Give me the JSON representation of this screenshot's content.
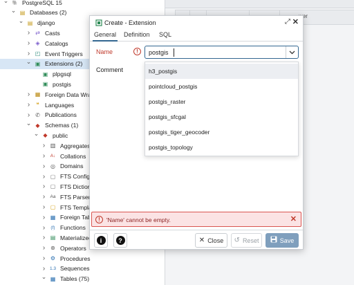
{
  "tree": {
    "items": [
      {
        "label": "PostgreSQL 15",
        "icon": "elephant-icon",
        "level": 0,
        "expanded": true,
        "selected": false
      },
      {
        "label": "Databases (2)",
        "icon": "database-group-icon",
        "level": 1,
        "expanded": true,
        "selected": false
      },
      {
        "label": "django",
        "icon": "database-icon",
        "level": 2,
        "expanded": true,
        "selected": false
      },
      {
        "label": "Casts",
        "icon": "cast-icon",
        "level": 3,
        "expanded": false,
        "selected": false
      },
      {
        "label": "Catalogs",
        "icon": "catalog-icon",
        "level": 3,
        "expanded": false,
        "selected": false
      },
      {
        "label": "Event Triggers",
        "icon": "event-trigger-icon",
        "level": 3,
        "expanded": false,
        "selected": false
      },
      {
        "label": "Extensions (2)",
        "icon": "extension-icon",
        "level": 3,
        "expanded": true,
        "selected": true
      },
      {
        "label": "plpgsql",
        "icon": "extension-icon",
        "level": 4,
        "expanded": null,
        "selected": false
      },
      {
        "label": "postgis",
        "icon": "extension-icon",
        "level": 4,
        "expanded": null,
        "selected": false
      },
      {
        "label": "Foreign Data Wrapp",
        "icon": "foreign-data-wrapper-icon",
        "level": 3,
        "expanded": false,
        "selected": false
      },
      {
        "label": "Languages",
        "icon": "language-icon",
        "level": 3,
        "expanded": false,
        "selected": false
      },
      {
        "label": "Publications",
        "icon": "publication-icon",
        "level": 3,
        "expanded": false,
        "selected": false
      },
      {
        "label": "Schemas (1)",
        "icon": "schema-group-icon",
        "level": 3,
        "expanded": true,
        "selected": false
      },
      {
        "label": "public",
        "icon": "schema-icon",
        "level": 4,
        "expanded": true,
        "selected": false
      },
      {
        "label": "Aggregates",
        "icon": "aggregate-icon",
        "level": 5,
        "expanded": false,
        "selected": false
      },
      {
        "label": "Collations",
        "icon": "collation-icon",
        "level": 5,
        "expanded": false,
        "selected": false
      },
      {
        "label": "Domains",
        "icon": "domain-icon",
        "level": 5,
        "expanded": false,
        "selected": false
      },
      {
        "label": "FTS Configura",
        "icon": "fts-configuration-icon",
        "level": 5,
        "expanded": false,
        "selected": false
      },
      {
        "label": "FTS Dictionari",
        "icon": "fts-dictionary-icon",
        "level": 5,
        "expanded": false,
        "selected": false
      },
      {
        "label": "FTS Parsers",
        "icon": "fts-parser-icon",
        "level": 5,
        "expanded": false,
        "selected": false
      },
      {
        "label": "FTS Templates",
        "icon": "fts-template-icon",
        "level": 5,
        "expanded": false,
        "selected": false
      },
      {
        "label": "Foreign Tables",
        "icon": "foreign-table-icon",
        "level": 5,
        "expanded": false,
        "selected": false
      },
      {
        "label": "Functions",
        "icon": "function-icon",
        "level": 5,
        "expanded": false,
        "selected": false
      },
      {
        "label": "Materialized V",
        "icon": "materialized-view-icon",
        "level": 5,
        "expanded": false,
        "selected": false
      },
      {
        "label": "Operators",
        "icon": "operator-icon",
        "level": 5,
        "expanded": false,
        "selected": false
      },
      {
        "label": "Procedures",
        "icon": "procedure-icon",
        "level": 5,
        "expanded": false,
        "selected": false
      },
      {
        "label": "Sequences",
        "icon": "sequence-icon",
        "level": 5,
        "expanded": false,
        "selected": false
      },
      {
        "label": "Tables (75)",
        "icon": "table-icon",
        "level": 5,
        "expanded": true,
        "selected": false
      }
    ]
  },
  "background": {
    "tab_text": "",
    "grid_header": "wer"
  },
  "dialog": {
    "title": "Create - Extension",
    "title_icon": "extension-icon",
    "tabs": [
      "General",
      "Definition",
      "SQL"
    ],
    "active_tab": "General",
    "name_label": "Name",
    "name_value": "postgis",
    "comment_label": "Comment",
    "options": [
      "h3_postgis",
      "pointcloud_postgis",
      "postgis_raster",
      "postgis_sfcgal",
      "postgis_tiger_geocoder",
      "postgis_topology"
    ],
    "highlighted_option": "h3_postgis",
    "error_message": "'Name' cannot be empty.",
    "buttons": {
      "info": "i",
      "help": "?",
      "close": "Close",
      "reset": "Reset",
      "save": "Save"
    }
  },
  "colors": {
    "accent": "#326690",
    "error": "#c0392b",
    "error_bg": "#fbe3e4",
    "selected_row": "#d7e6f5",
    "save_button": "#7f9fbd"
  }
}
